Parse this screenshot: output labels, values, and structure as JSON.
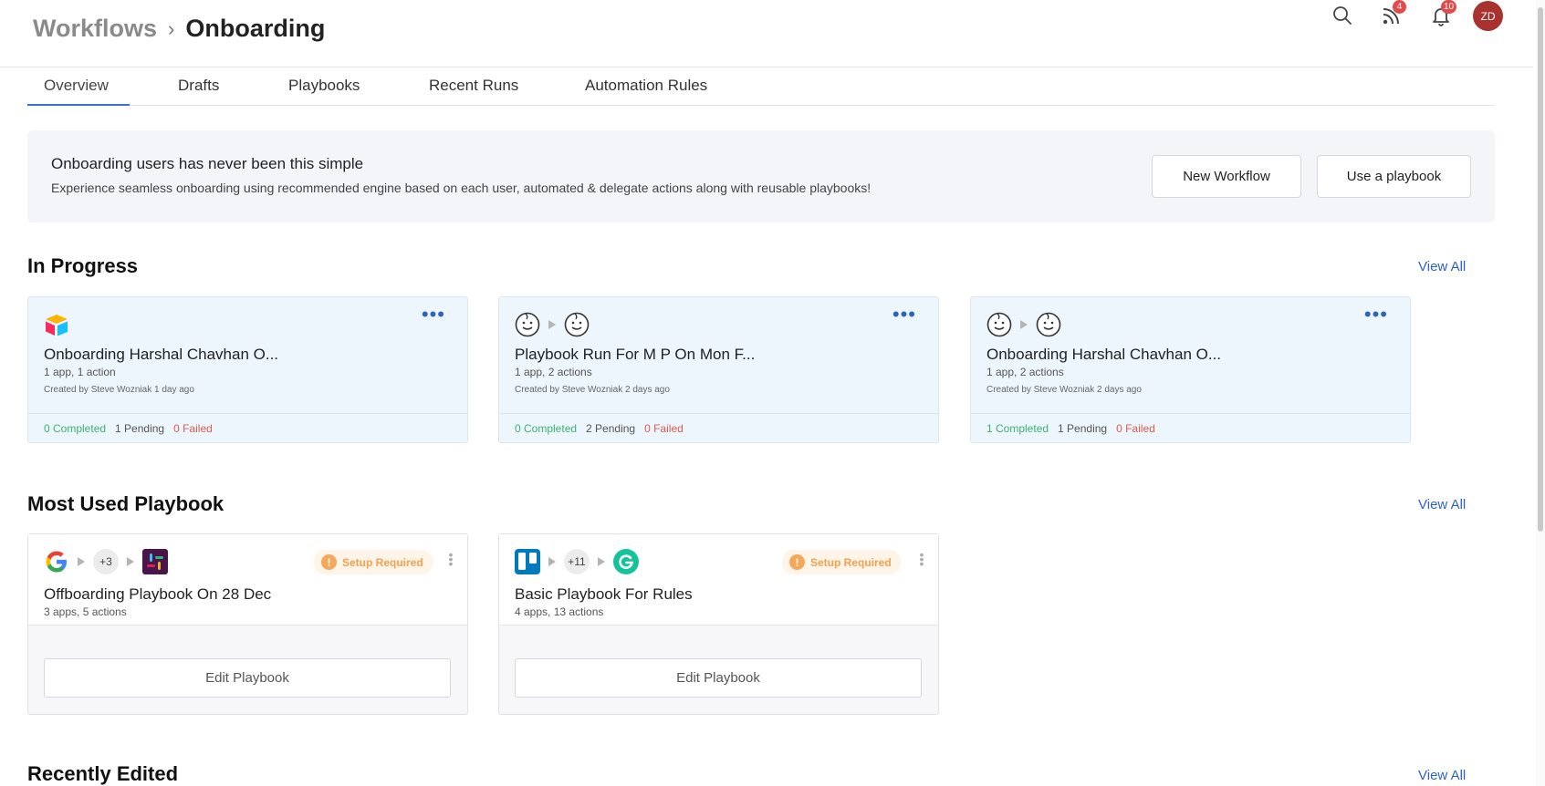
{
  "header": {
    "breadcrumb_root": "Workflows",
    "breadcrumb_sep": "›",
    "breadcrumb_current": "Onboarding",
    "feed_badge": "4",
    "notif_badge": "10",
    "avatar_initials": "ZD"
  },
  "tabs": [
    {
      "label": "Overview",
      "active": true
    },
    {
      "label": "Drafts",
      "active": false
    },
    {
      "label": "Playbooks",
      "active": false
    },
    {
      "label": "Recent Runs",
      "active": false
    },
    {
      "label": "Automation Rules",
      "active": false
    }
  ],
  "banner": {
    "title": "Onboarding users has never been this simple",
    "subtitle": "Experience seamless onboarding using recommended engine based on each user, automated & delegate actions along with reusable playbooks!",
    "new_workflow_label": "New Workflow",
    "use_playbook_label": "Use a playbook"
  },
  "in_progress": {
    "title": "In Progress",
    "view_all": "View All",
    "cards": [
      {
        "title": "Onboarding Harshal Chavhan O...",
        "summary": "1 app, 1 action",
        "creator": "Created by Steve Wozniak 1 day ago",
        "completed": "0 Completed",
        "pending": "1 Pending",
        "failed": "0 Failed"
      },
      {
        "title": "Playbook Run For M P On Mon F...",
        "summary": "1 app, 2 actions",
        "creator": "Created by Steve Wozniak 2 days ago",
        "completed": "0 Completed",
        "pending": "2 Pending",
        "failed": "0 Failed"
      },
      {
        "title": "Onboarding Harshal Chavhan O...",
        "summary": "1 app, 2 actions",
        "creator": "Created by Steve Wozniak 2 days ago",
        "completed": "1 Completed",
        "pending": "1 Pending",
        "failed": "0 Failed"
      }
    ]
  },
  "most_used": {
    "title": "Most Used Playbook",
    "view_all": "View All",
    "cards": [
      {
        "extra_apps": "+3",
        "badge": "Setup Required",
        "title": "Offboarding Playbook On 28 Dec",
        "summary": "3 apps, 5 actions",
        "edit_label": "Edit Playbook"
      },
      {
        "extra_apps": "+11",
        "badge": "Setup Required",
        "title": "Basic Playbook For Rules",
        "summary": "4 apps, 13 actions",
        "edit_label": "Edit Playbook"
      }
    ]
  },
  "recently_edited": {
    "title": "Recently Edited",
    "view_all": "View All"
  },
  "colors": {
    "accent": "#2b63c4",
    "success": "#3cb371",
    "danger": "#e35a4b",
    "warning": "#f3a04f",
    "avatar": "#a8322e"
  }
}
